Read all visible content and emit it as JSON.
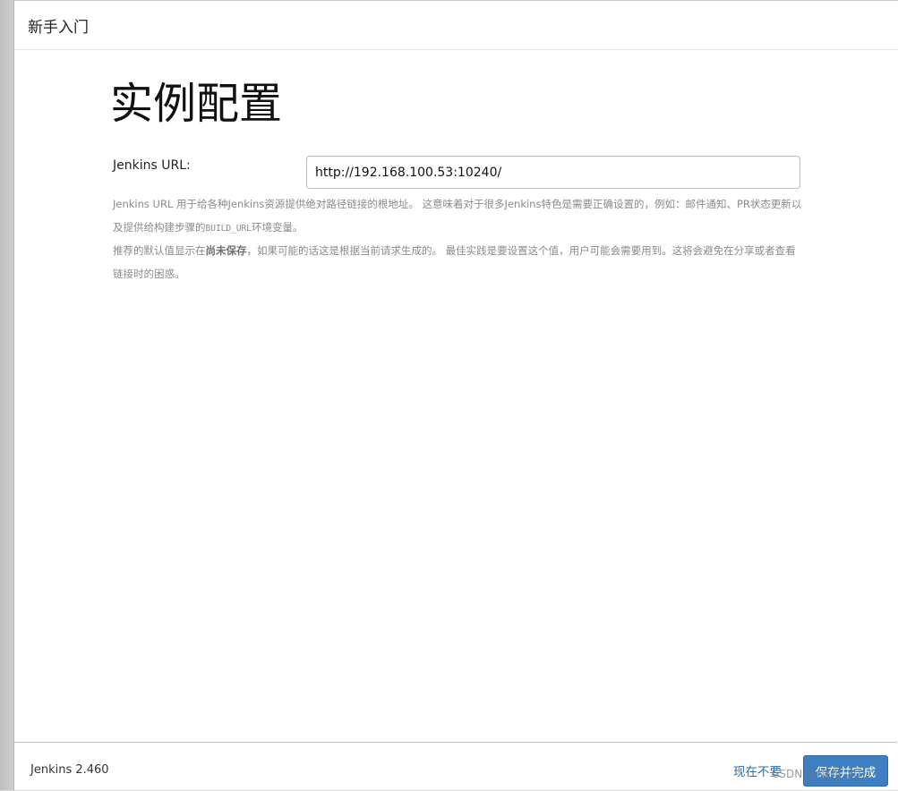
{
  "dialog": {
    "title": "新手入门"
  },
  "page": {
    "heading": "实例配置"
  },
  "form": {
    "url_label": "Jenkins URL:",
    "url_value": "http://192.168.100.53:10240/"
  },
  "help": {
    "p1_before_code": "Jenkins URL 用于给各种Jenkins资源提供绝对路径链接的根地址。 这意味着对于很多Jenkins特色是需要正确设置的，例如：邮件通知、PR状态更新以及提供给构建步骤的",
    "p1_code": "BUILD_URL",
    "p1_after_code": "环境变量。",
    "p2_before_bold": "推荐的默认值显示在",
    "p2_bold": "尚未保存",
    "p2_after_bold": "，如果可能的话这是根据当前请求生成的。 最佳实践是要设置这个值，用户可能会需要用到。这将会避免在分享或者查看链接时的困惑。"
  },
  "footer": {
    "version": "Jenkins 2.460",
    "skip_label": "现在不要",
    "save_label": "保存并完成"
  },
  "watermark": {
    "text": "CSDN @NEIL_XU_"
  }
}
